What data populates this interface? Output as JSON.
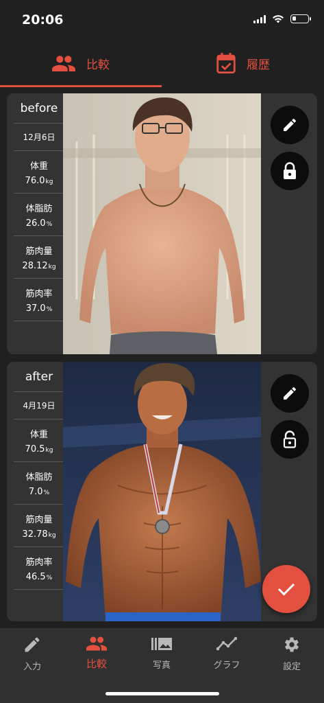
{
  "status_bar": {
    "time": "20:06",
    "battery_level": 0.18
  },
  "top_tabs": [
    {
      "label": "比較",
      "icon": "people-icon",
      "active": true
    },
    {
      "label": "履歴",
      "icon": "calendar-check-icon",
      "active": false
    }
  ],
  "cards": {
    "before": {
      "title": "before",
      "date": "12月6日",
      "metrics": [
        {
          "label": "体重",
          "value": "76.0",
          "unit": "kg"
        },
        {
          "label": "体脂肪",
          "value": "26.0",
          "unit": "%"
        },
        {
          "label": "筋肉量",
          "value": "28.12",
          "unit": "kg"
        },
        {
          "label": "筋肉率",
          "value": "37.0",
          "unit": "%"
        }
      ],
      "edit_icon": "pencil-icon",
      "lock_icon": "lock-closed-icon"
    },
    "after": {
      "title": "after",
      "date": "4月19日",
      "metrics": [
        {
          "label": "体重",
          "value": "70.5",
          "unit": "kg"
        },
        {
          "label": "体脂肪",
          "value": "7.0",
          "unit": "%"
        },
        {
          "label": "筋肉量",
          "value": "32.78",
          "unit": "kg"
        },
        {
          "label": "筋肉率",
          "value": "46.5",
          "unit": "%"
        }
      ],
      "edit_icon": "pencil-icon",
      "lock_icon": "lock-open-icon"
    }
  },
  "fab_icon": "check-icon",
  "bottom_nav": [
    {
      "label": "入力",
      "icon": "pencil-icon"
    },
    {
      "label": "比較",
      "icon": "people-icon"
    },
    {
      "label": "写真",
      "icon": "photo-library-icon"
    },
    {
      "label": "グラフ",
      "icon": "line-chart-icon"
    },
    {
      "label": "設定",
      "icon": "gear-icon"
    }
  ],
  "colors": {
    "accent": "#e4503f",
    "background": "#202020",
    "card": "#333333",
    "nav": "#303030"
  }
}
